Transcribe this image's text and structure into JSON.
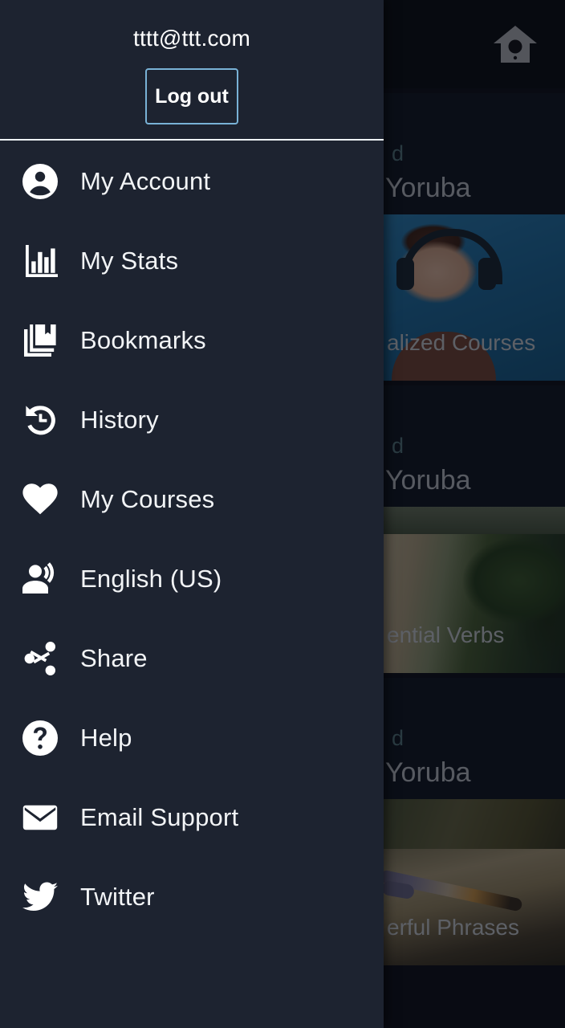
{
  "drawer": {
    "account_email": "tttt@ttt.com",
    "logout_label": "Log out",
    "accent_border_color": "#79b2d6",
    "background_color": "#1d2330",
    "divider_color": "#eef2f5",
    "items": [
      {
        "label": "My Account",
        "icon": "account-circle-icon"
      },
      {
        "label": "My Stats",
        "icon": "bar-chart-icon"
      },
      {
        "label": "Bookmarks",
        "icon": "library-books-icon"
      },
      {
        "label": "History",
        "icon": "restore-clock-icon"
      },
      {
        "label": "My Courses",
        "icon": "heart-icon"
      },
      {
        "label": "English (US)",
        "icon": "record-voice-over-icon"
      },
      {
        "label": "Share",
        "icon": "share-icon"
      },
      {
        "label": "Help",
        "icon": "help-circle-icon"
      },
      {
        "label": "Email Support",
        "icon": "envelope-icon"
      },
      {
        "label": "Twitter",
        "icon": "twitter-bird-icon"
      }
    ]
  },
  "background": {
    "appbar": {
      "home_icon": "birdhouse-home-icon"
    },
    "cards": [
      {
        "eyebrow": "d",
        "title": "Yoruba",
        "caption": "alized Courses",
        "image": "woman-with-headphones-and-blue-sunglasses"
      },
      {
        "eyebrow": "d",
        "title": "Yoruba",
        "caption": "ential Verbs",
        "image": "river-through-green-forest"
      },
      {
        "eyebrow": "d",
        "title": "Yoruba",
        "caption": "erful Phrases",
        "image": "lizard-on-a-log"
      }
    ]
  }
}
